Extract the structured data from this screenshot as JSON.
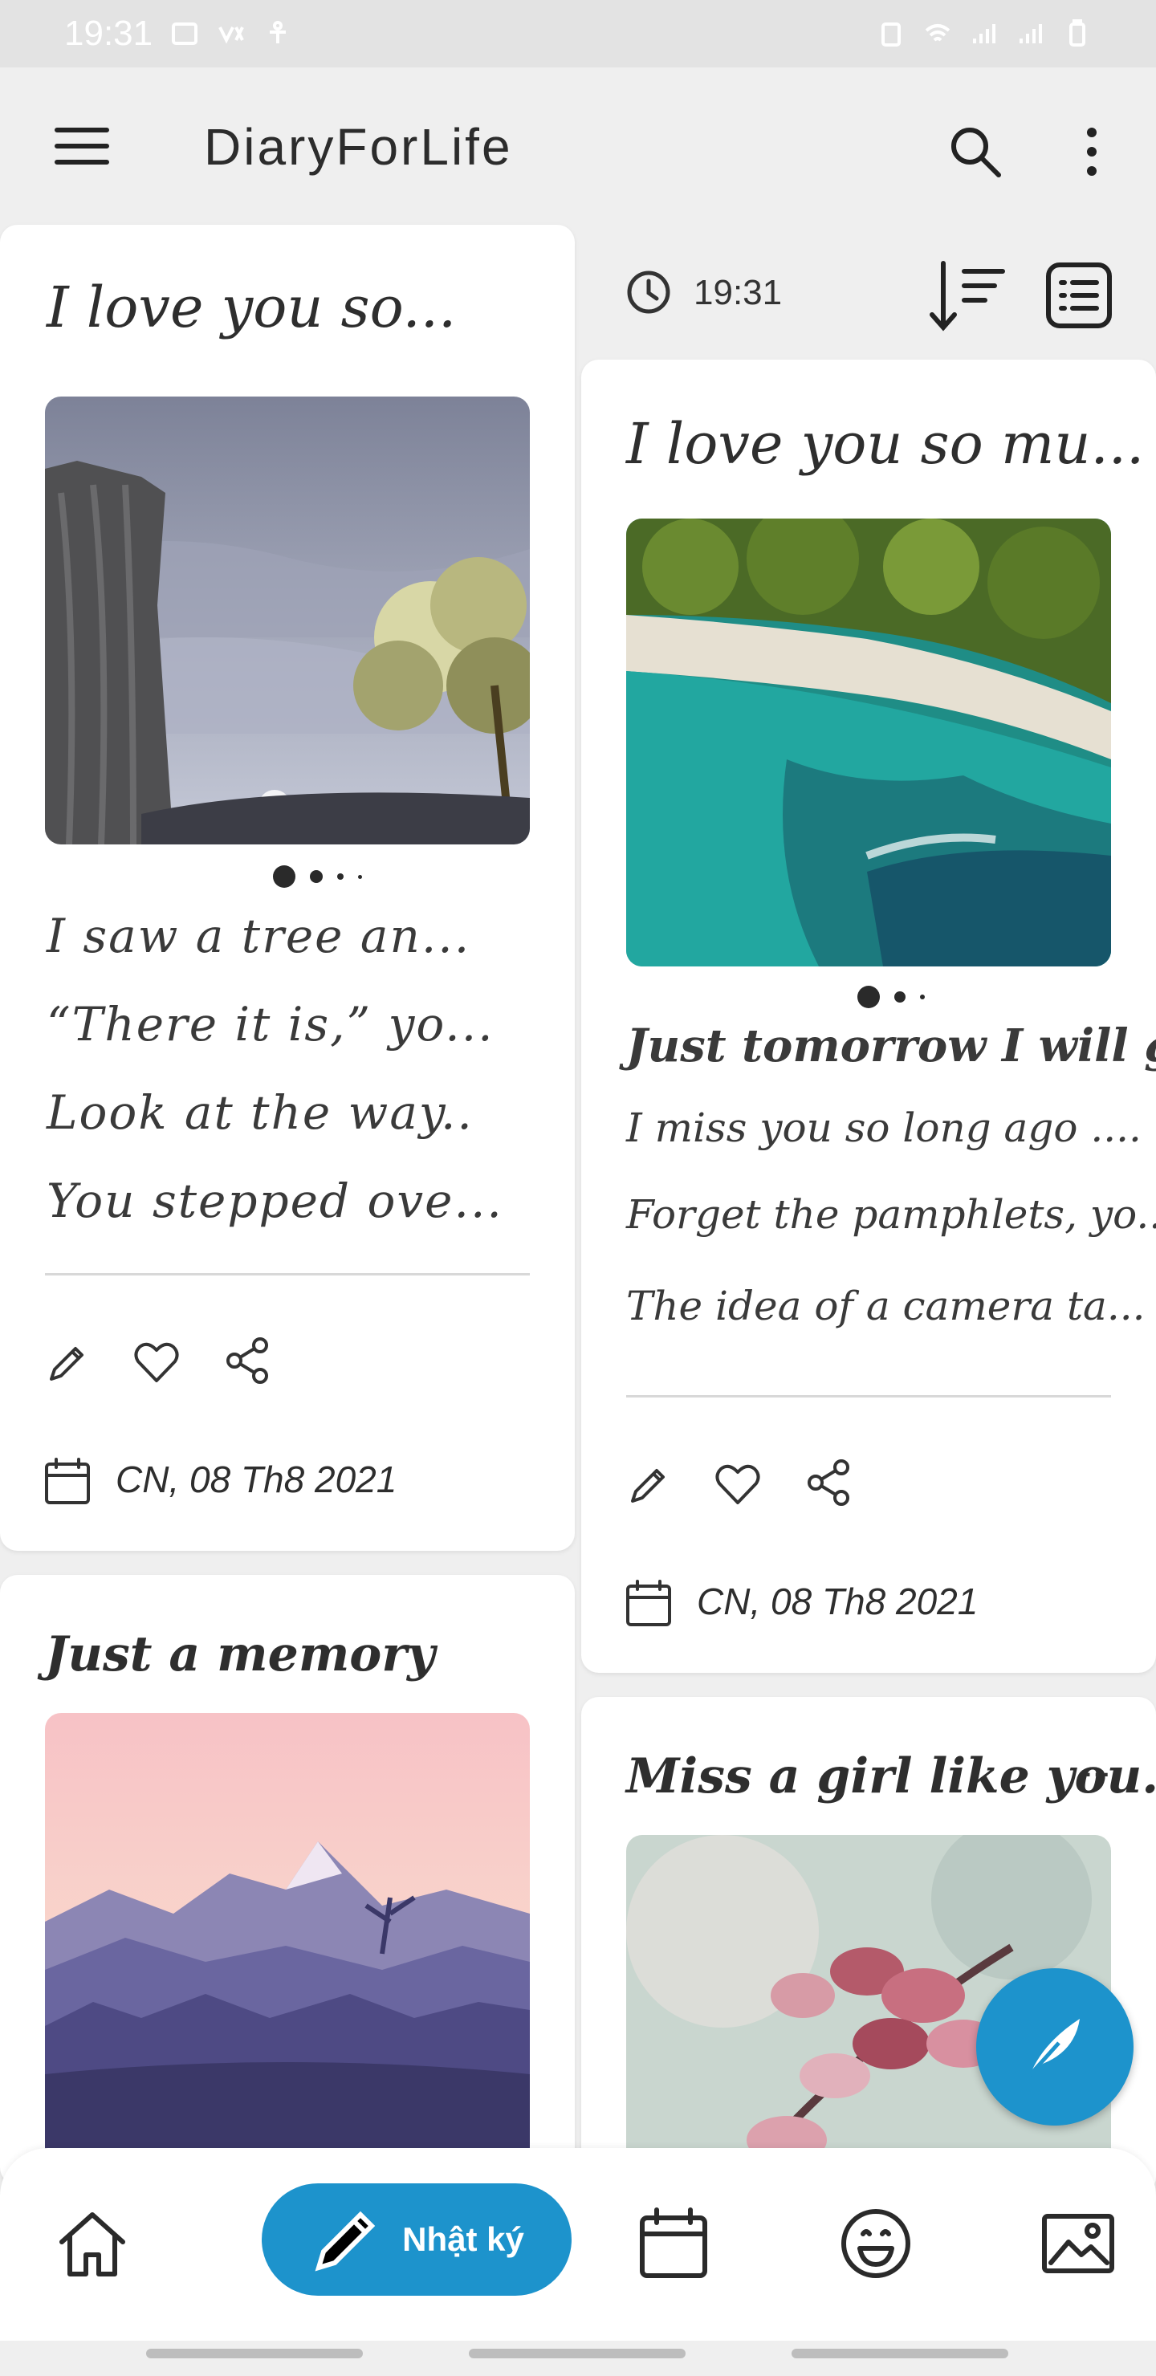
{
  "status": {
    "time": "19:31"
  },
  "app": {
    "title": "DiaryForLife"
  },
  "toolbar": {
    "time": "19:31"
  },
  "cards": [
    {
      "title": "I love you so...",
      "lines": [
        "I saw a tree an...",
        "“There it is,” yo...",
        "Look at the way..",
        "You stepped ove..."
      ],
      "date": "CN, 08 Th8 2021"
    },
    {
      "title": "I love you so mu...",
      "subtitle": "Just tomorrow I will go...",
      "lines": [
        "I miss you so long ago ....",
        "Forget the pamphlets, yo...",
        "The idea of a camera ta..."
      ],
      "date": "CN, 08 Th8 2021"
    },
    {
      "title": "Just a memory"
    },
    {
      "title": "Miss a girl like you...",
      "more": "..."
    }
  ],
  "nav": {
    "diary_label": "Nhật ký"
  },
  "colors": {
    "accent": "#1d93cc",
    "background": "#efefef",
    "card": "#ffffff"
  }
}
